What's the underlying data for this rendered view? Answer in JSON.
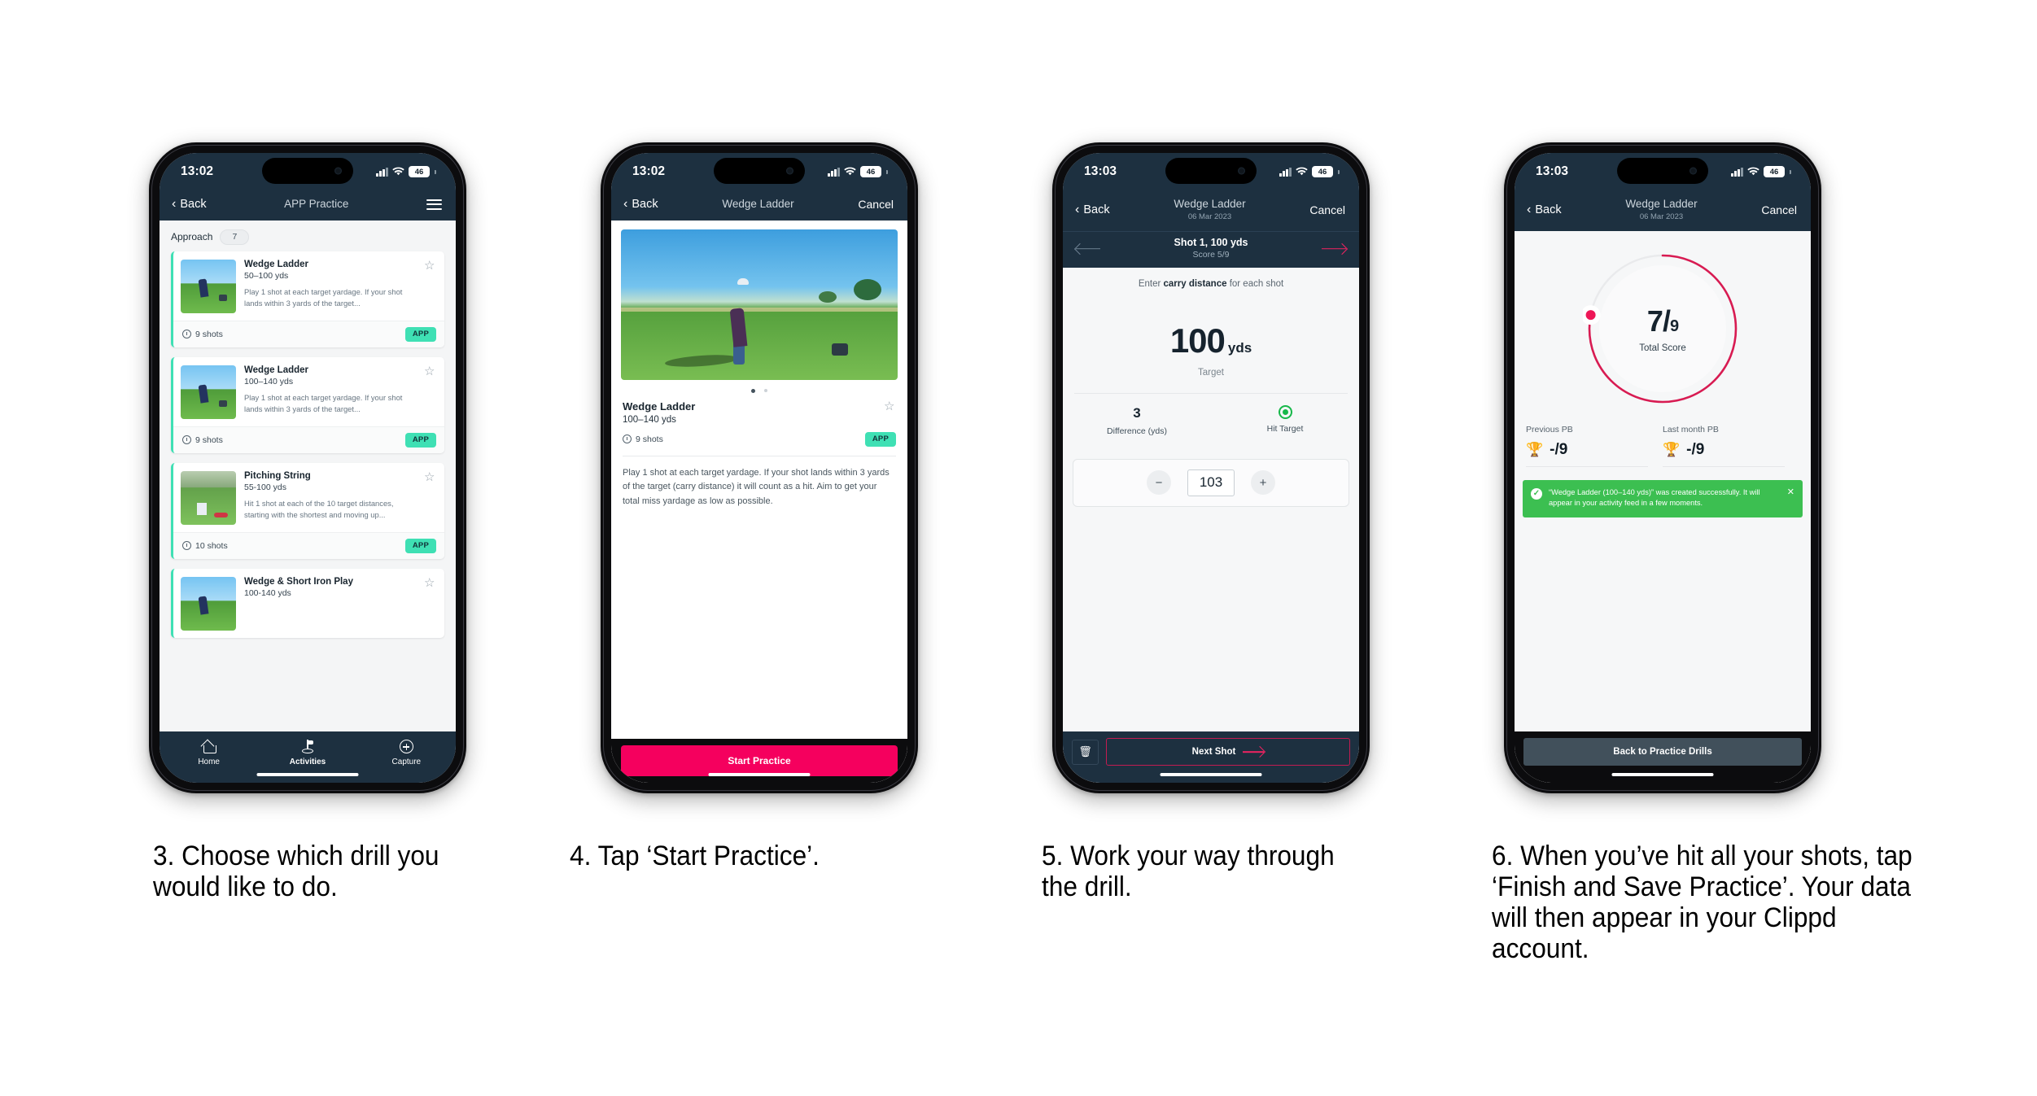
{
  "colors": {
    "header_navy": "#1d3040",
    "accent_pink": "#f5005e",
    "accent_teal": "#3fe0b4",
    "toast_green": "#3cbf51",
    "hit_green": "#17b84a"
  },
  "phones": [
    {
      "id": "phone-app-practice",
      "status": {
        "time": "13:02",
        "battery": "46"
      },
      "nav": {
        "back": "Back",
        "title": "APP Practice",
        "menu_icon": "hamburger-icon"
      },
      "category": {
        "label": "Approach",
        "count": "7"
      },
      "cards": [
        {
          "title": "Wedge Ladder",
          "range": "50–100 yds",
          "desc": "Play 1 shot at each target yardage. If your shot lands within 3 yards of the target...",
          "shots": "9 shots",
          "badge": "APP"
        },
        {
          "title": "Wedge Ladder",
          "range": "100–140 yds",
          "desc": "Play 1 shot at each target yardage. If your shot lands within 3 yards of the target...",
          "shots": "9 shots",
          "badge": "APP"
        },
        {
          "title": "Pitching String",
          "range": "55-100 yds",
          "desc": "Hit 1 shot at each of the 10 target distances, starting with the shortest and moving up...",
          "shots": "10 shots",
          "badge": "APP"
        },
        {
          "title": "Wedge & Short Iron Play",
          "range": "100-140 yds",
          "desc": "",
          "shots": "",
          "badge": ""
        }
      ],
      "tabs": [
        {
          "label": "Home",
          "icon": "home-icon"
        },
        {
          "label": "Activities",
          "icon": "golf-flag-icon"
        },
        {
          "label": "Capture",
          "icon": "plus-circle-icon"
        }
      ]
    },
    {
      "id": "phone-drill-detail",
      "status": {
        "time": "13:02",
        "battery": "46"
      },
      "nav": {
        "back": "Back",
        "title": "Wedge Ladder",
        "right": "Cancel"
      },
      "detail": {
        "title": "Wedge Ladder",
        "range": "100–140 yds",
        "shots": "9 shots",
        "badge": "APP",
        "description": "Play 1 shot at each target yardage. If your shot lands within 3 yards of the target (carry distance) it will count as a hit. Aim to get your total miss yardage as low as possible."
      },
      "cta": "Start Practice"
    },
    {
      "id": "phone-shot-entry",
      "status": {
        "time": "13:03",
        "battery": "46"
      },
      "nav": {
        "back": "Back",
        "title": "Wedge Ladder",
        "subtitle": "06 Mar 2023",
        "right": "Cancel"
      },
      "shotbar": {
        "title": "Shot 1, 100 yds",
        "score": "Score 5/9"
      },
      "hint_prefix": "Enter ",
      "hint_bold": "carry distance",
      "hint_suffix": " for each shot",
      "target": {
        "value": "100",
        "unit": "yds",
        "caption": "Target"
      },
      "stats": [
        {
          "value": "3",
          "label": "Difference (yds)"
        },
        {
          "value": "",
          "label": "Hit Target",
          "icon": "target-hit-icon"
        }
      ],
      "stepper": {
        "minus": "−",
        "value": "103",
        "plus": "+"
      },
      "footer": {
        "delete_icon": "trash-icon",
        "next": "Next Shot"
      }
    },
    {
      "id": "phone-summary",
      "status": {
        "time": "13:03",
        "battery": "46"
      },
      "nav": {
        "back": "Back",
        "title": "Wedge Ladder",
        "subtitle": "06 Mar 2023",
        "right": "Cancel"
      },
      "ring": {
        "numerator": "7",
        "denominator": "9",
        "label": "Total Score",
        "percent": 78
      },
      "pbs": [
        {
          "label": "Previous PB",
          "value": "-/9",
          "icon": "trophy-icon"
        },
        {
          "label": "Last month PB",
          "value": "-/9",
          "icon": "trophy-icon"
        }
      ],
      "toast": {
        "message": "“Wedge Ladder (100–140 yds)” was created successfully. It will appear in your activity feed in a few moments.",
        "close_icon": "close-icon",
        "check_icon": "check-icon"
      },
      "footer_button": "Back to Practice Drills"
    }
  ],
  "captions": [
    "3. Choose which drill you would like to do.",
    "4. Tap ‘Start Practice’.",
    "5. Work your way through the drill.",
    "6. When you’ve hit all your shots, tap ‘Finish and Save Practice’. Your data will then appear in your Clippd account."
  ]
}
